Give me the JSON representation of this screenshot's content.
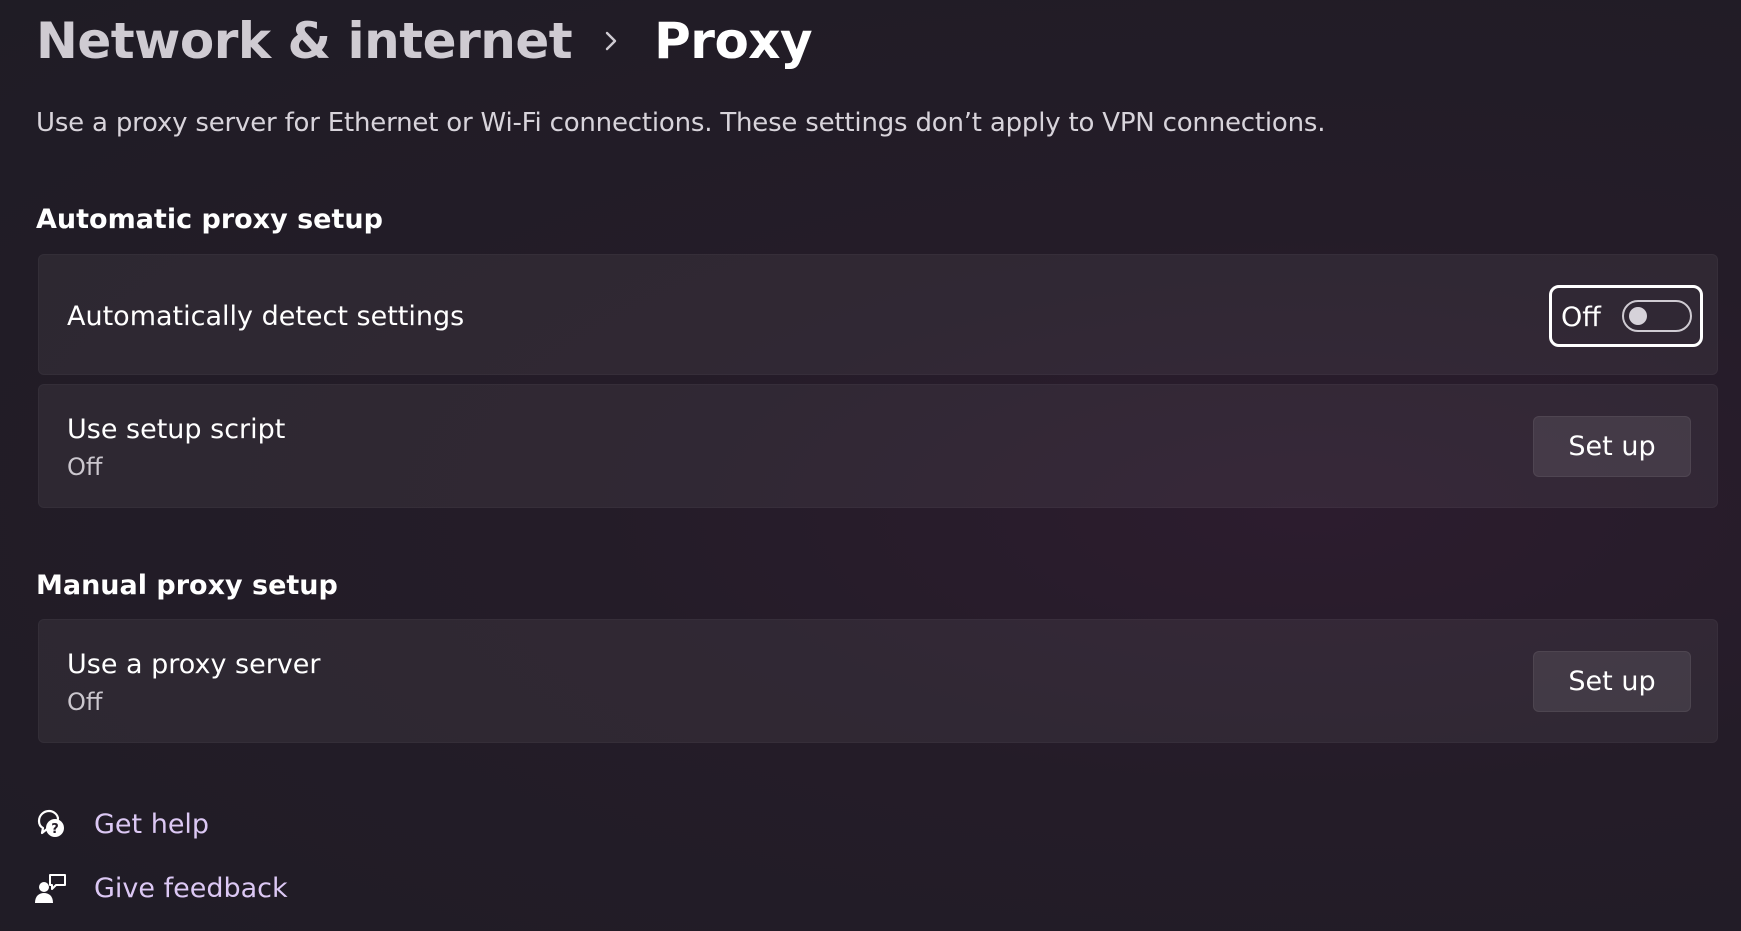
{
  "breadcrumb": {
    "parent": "Network & internet",
    "separator_icon": "chevron-right-icon",
    "current": "Proxy"
  },
  "description": "Use a proxy server for Ethernet or Wi-Fi connections. These settings don’t apply to VPN connections.",
  "automatic": {
    "title": "Automatic proxy setup",
    "detect": {
      "label": "Automatically detect settings",
      "toggle_text": "Off",
      "toggle_on": false
    },
    "script": {
      "label": "Use setup script",
      "status": "Off",
      "button": "Set up"
    }
  },
  "manual": {
    "title": "Manual proxy setup",
    "proxy": {
      "label": "Use a proxy server",
      "status": "Off",
      "button": "Set up"
    }
  },
  "links": {
    "help": {
      "label": "Get help",
      "icon": "help-chat-icon"
    },
    "feedback": {
      "label": "Give feedback",
      "icon": "feedback-person-icon"
    }
  },
  "colors": {
    "link": "#dcc8f4",
    "background": "#241c28",
    "card": "#2e2833"
  }
}
